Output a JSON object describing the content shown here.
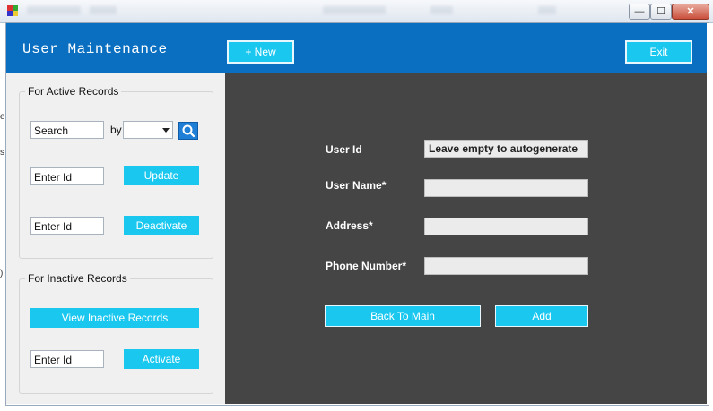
{
  "window": {
    "title": "",
    "controls": {
      "minimize": "—",
      "maximize": "☐",
      "close": "✕"
    }
  },
  "header": {
    "title": "User Maintenance",
    "new_button": "+ New",
    "exit_button": "Exit"
  },
  "active_records": {
    "group_label": "For Active Records",
    "search_value": "Search",
    "by_label": "by",
    "combo_value": "",
    "update_id_value": "Enter Id",
    "update_button": "Update",
    "deactivate_id_value": "Enter Id",
    "deactivate_button": "Deactivate"
  },
  "inactive_records": {
    "group_label": "For Inactive Records",
    "view_button": "View Inactive Records",
    "activate_id_value": "Enter Id",
    "activate_button": "Activate"
  },
  "form": {
    "user_id_label": "User Id",
    "user_id_value": "Leave empty to autogenerate",
    "user_name_label": "User Name*",
    "user_name_value": "",
    "address_label": "Address*",
    "address_value": "",
    "phone_label": "Phone Number*",
    "phone_value": "",
    "back_button": "Back To Main",
    "add_button": "Add"
  },
  "colors": {
    "header_blue": "#0a6fc0",
    "button_cyan": "#19c7ef",
    "form_background": "#454545",
    "panel_gray": "#f0f0f0"
  },
  "icons": {
    "search": "search-icon",
    "app": "app-icon"
  }
}
